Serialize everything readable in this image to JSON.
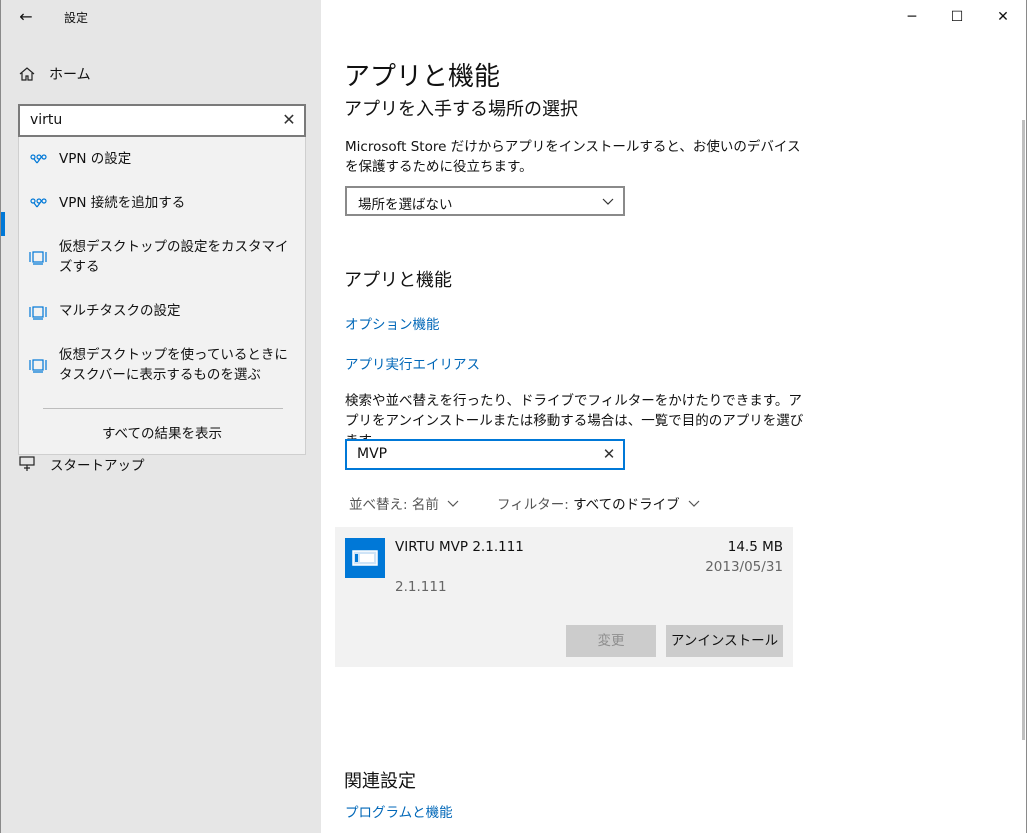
{
  "window": {
    "title": "設定",
    "back_icon": "back-arrow-icon",
    "controls": {
      "minimize": "minimize-icon",
      "maximize": "maximize-icon",
      "close": "close-icon"
    }
  },
  "sidebar": {
    "home_label": "ホーム",
    "search": {
      "value": "virtu",
      "clear_icon": "clear-icon"
    },
    "suggestions": [
      {
        "label": "VPN の設定",
        "icon": "vpn-icon"
      },
      {
        "label": "VPN 接続を追加する",
        "icon": "vpn-icon"
      },
      {
        "label": "仮想デスクトップの設定をカスタマイズする",
        "icon": "multitask-icon"
      },
      {
        "label": "マルチタスクの設定",
        "icon": "multitask-icon"
      },
      {
        "label": "仮想デスクトップを使っているときにタスクバーに表示するものを選ぶ",
        "icon": "multitask-icon"
      }
    ],
    "show_all_label": "すべての結果を表示",
    "startup_label": "スタートアップ"
  },
  "main": {
    "page_title": "アプリと機能",
    "source_section_title": "アプリを入手する場所の選択",
    "source_desc": "Microsoft Store だけからアプリをインストールすると、お使いのデバイスを保護するために役立ちます。",
    "source_select_value": "場所を選ばない",
    "apps_section_title": "アプリと機能",
    "optional_features_link": "オプション機能",
    "app_aliases_link": "アプリ実行エイリアス",
    "apps_desc": "検索や並べ替えを行ったり、ドライブでフィルターをかけたりできます。アプリをアンインストールまたは移動する場合は、一覧で目的のアプリを選びます。",
    "app_search_value": "MVP",
    "sort": {
      "label": "並べ替え:",
      "value": "名前"
    },
    "filter": {
      "label": "フィルター:",
      "value": "すべてのドライブ"
    },
    "apps": [
      {
        "name": "VIRTU MVP 2.1.111",
        "size": "14.5 MB",
        "date": "2013/05/31",
        "version": "2.1.111",
        "modify_label": "変更",
        "uninstall_label": "アンインストール"
      }
    ],
    "related_title": "関連設定",
    "related_link": "プログラムと機能"
  },
  "colors": {
    "accent": "#0078d7",
    "link": "#0067b8",
    "sidebar_bg": "#e6e6e6",
    "card_bg": "#f2f2f2"
  }
}
